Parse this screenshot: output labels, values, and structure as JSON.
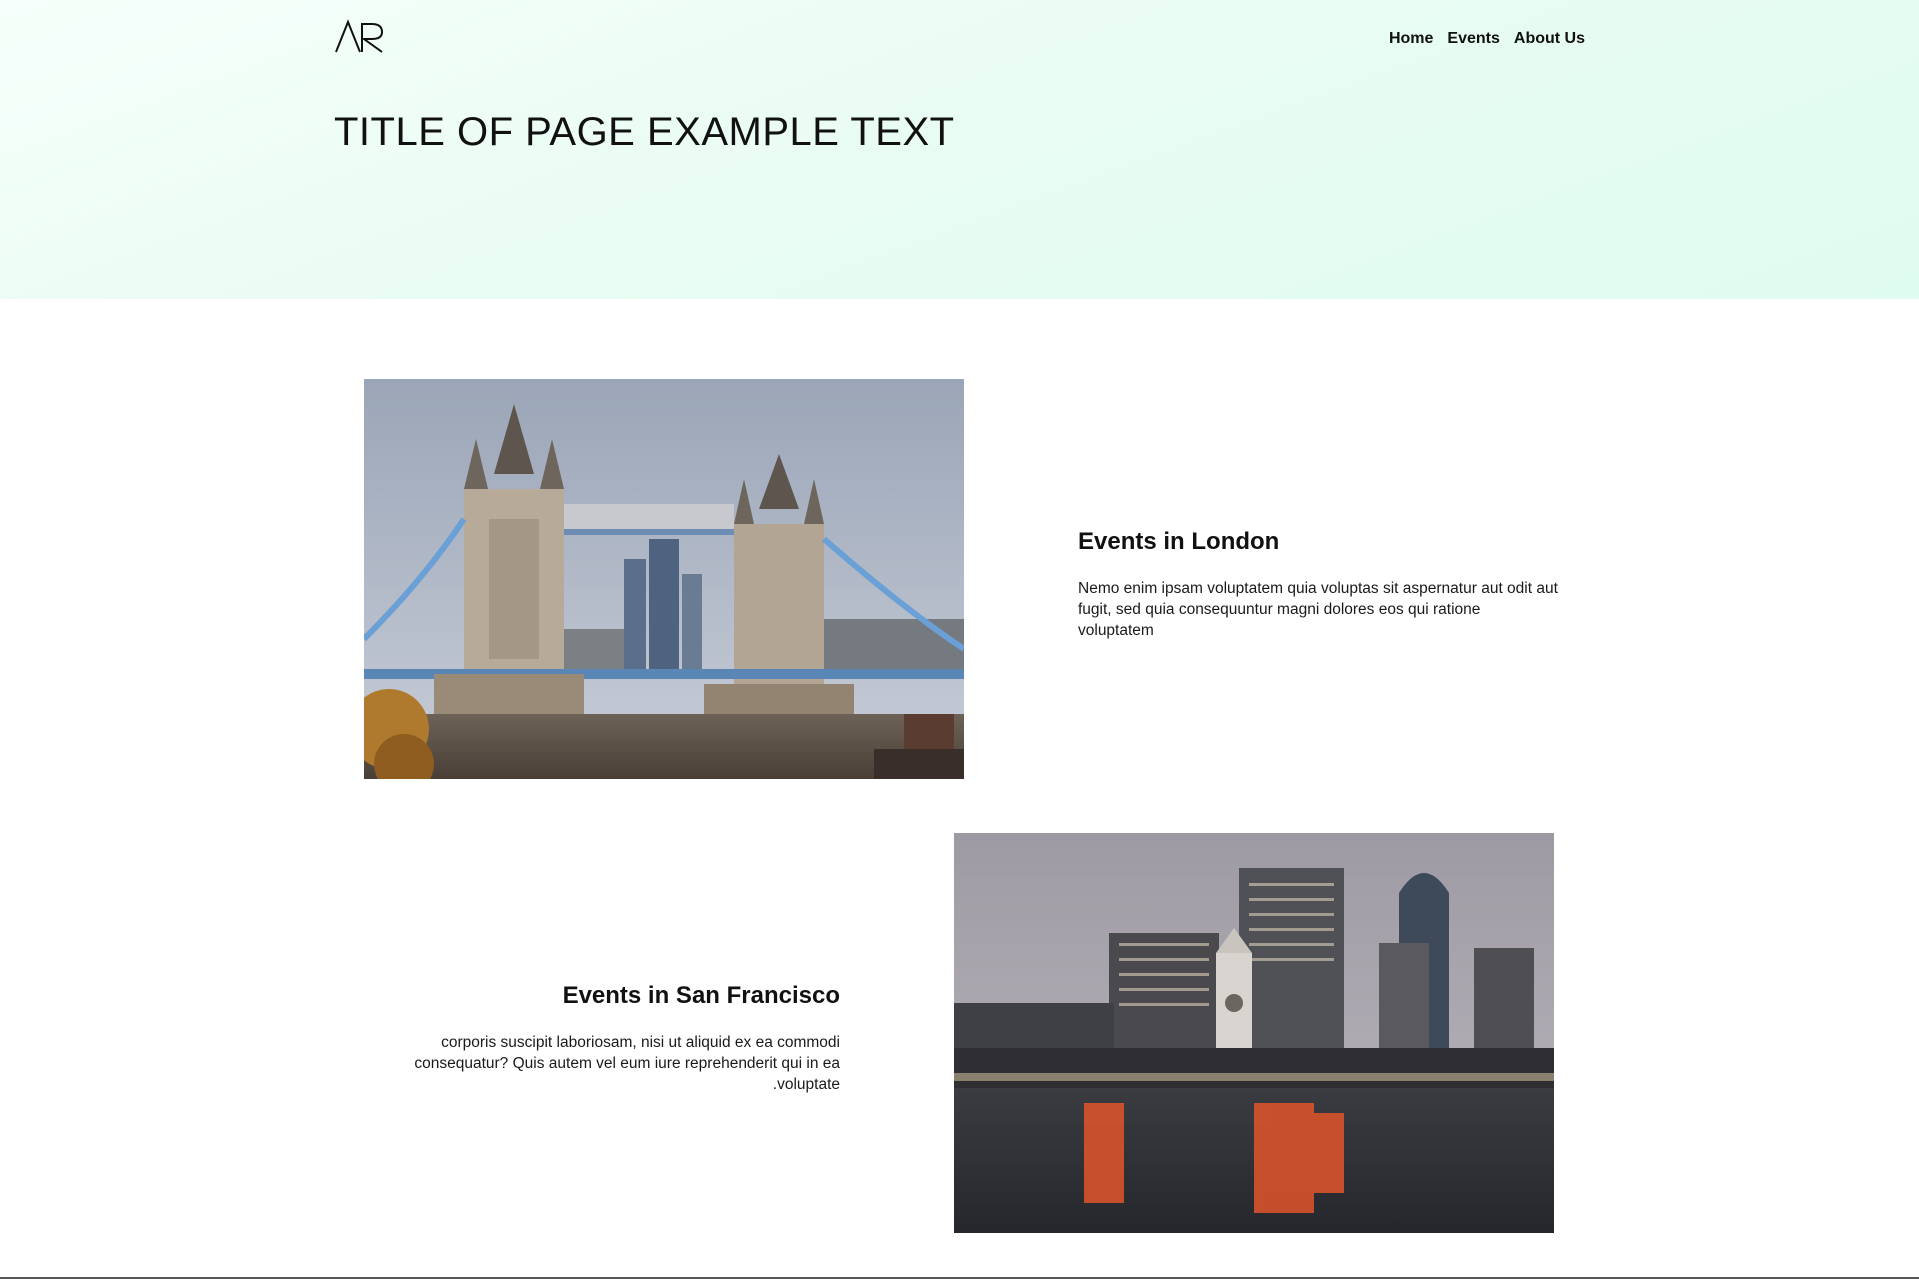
{
  "header": {
    "logo_text": "AR",
    "nav": [
      {
        "label": "Home"
      },
      {
        "label": "Events"
      },
      {
        "label": "About Us"
      }
    ],
    "title": "TITLE OF PAGE EXAMPLE TEXT"
  },
  "events": [
    {
      "title": "Events in London",
      "description": "Nemo enim ipsam voluptatem quia voluptas sit aspernatur aut odit aut fugit, sed quia consequuntur magni dolores eos qui ratione voluptatem",
      "image": "tower-bridge-photo"
    },
    {
      "title": "Events in San Francisco",
      "description": "corporis suscipit laboriosam, nisi ut aliquid ex ea commodi consequatur? Quis autem vel eum iure reprehenderit qui in ea .voluptate",
      "image": "san-francisco-skyline-photo"
    }
  ],
  "colors": {
    "hero_start": "#f6fffb",
    "hero_end": "#dffcf0",
    "text": "#111111"
  }
}
